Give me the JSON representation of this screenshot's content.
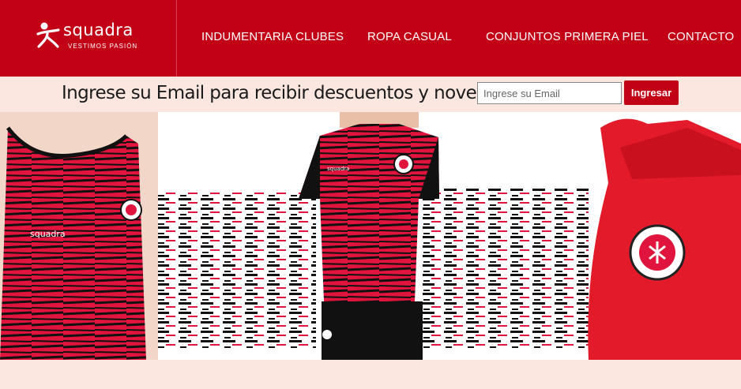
{
  "brand": {
    "name": "squadra",
    "tagline": "VESTIMOS PASIÓN",
    "logo_icon": "runner-figure-icon"
  },
  "nav": {
    "items": [
      {
        "label": "INDUMENTARIA CLUBES"
      },
      {
        "label": "ROPA CASUAL"
      },
      {
        "label": "CONJUNTOS PRIMERA PIEL"
      },
      {
        "label": "CONTACTO"
      }
    ]
  },
  "subscribe": {
    "prompt": "Ingrese su Email para recibir descuentos y novedades:",
    "placeholder": "Ingrese su Email",
    "value": "",
    "button_label": "Ingresar"
  },
  "banner": {
    "jersey_brand_text": "squadra"
  },
  "colors": {
    "brand_red": "#c20016",
    "band_bg": "#fce6e0",
    "jersey_red": "#e0143c",
    "jersey_black": "#111111"
  }
}
